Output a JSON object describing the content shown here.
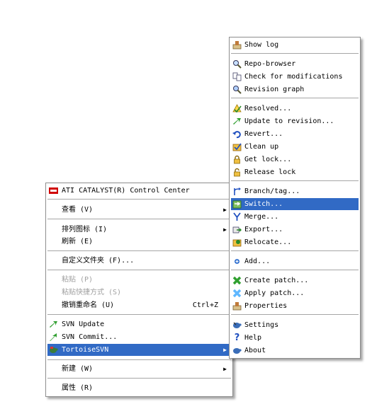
{
  "context_menu": {
    "items": [
      {
        "label": "ATI CATALYST(R) Control Center"
      },
      {
        "label": "查看 (V)"
      },
      {
        "label": "排列图标 (I)"
      },
      {
        "label": "刷新 (E)"
      },
      {
        "label": "自定义文件夹 (F)..."
      },
      {
        "label": "粘贴 (P)"
      },
      {
        "label": "粘贴快捷方式 (S)"
      },
      {
        "label": "撤销重命名 (U)",
        "shortcut": "Ctrl+Z"
      },
      {
        "label": "SVN Update"
      },
      {
        "label": "SVN Commit..."
      },
      {
        "label": "TortoiseSVN"
      },
      {
        "label": "新建 (W)"
      },
      {
        "label": "属性 (R)"
      }
    ],
    "submenu_arrow": "▶"
  },
  "svn_menu": {
    "items": [
      {
        "label": "Show log"
      },
      {
        "label": "Repo-browser"
      },
      {
        "label": "Check for modifications"
      },
      {
        "label": "Revision graph"
      },
      {
        "label": "Resolved..."
      },
      {
        "label": "Update to revision..."
      },
      {
        "label": "Revert..."
      },
      {
        "label": "Clean up"
      },
      {
        "label": "Get lock..."
      },
      {
        "label": "Release lock"
      },
      {
        "label": "Branch/tag..."
      },
      {
        "label": "Switch..."
      },
      {
        "label": "Merge..."
      },
      {
        "label": "Export..."
      },
      {
        "label": "Relocate..."
      },
      {
        "label": "Add..."
      },
      {
        "label": "Create patch..."
      },
      {
        "label": "Apply patch..."
      },
      {
        "label": "Properties"
      },
      {
        "label": "Settings"
      },
      {
        "label": "Help"
      },
      {
        "label": "About"
      }
    ]
  },
  "colors": {
    "selection": "#316ac5",
    "disabled_text": "#a0a0a0"
  }
}
